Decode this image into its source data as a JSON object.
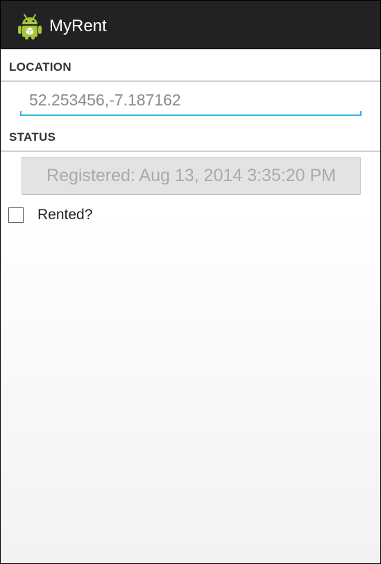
{
  "action_bar": {
    "icon": "android-app-icon",
    "title": "MyRent"
  },
  "location": {
    "header": "LOCATION",
    "value": "52.253456,-7.187162"
  },
  "status": {
    "header": "STATUS",
    "registered_button": "Registered: Aug 13, 2014 3:35:20 PM",
    "rented_checkbox": {
      "label": "Rented?",
      "checked": false
    }
  },
  "colors": {
    "action_bar_bg": "#222222",
    "accent": "#33b5e5",
    "header_divider": "#cfcfcf"
  }
}
